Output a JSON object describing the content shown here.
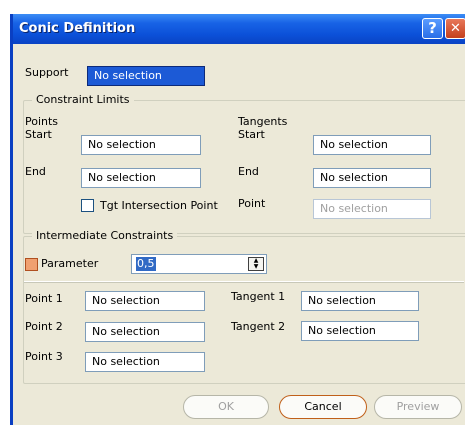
{
  "window": {
    "title": "Conic Definition",
    "help_glyph": "?",
    "close_glyph": "✕"
  },
  "support": {
    "label": "Support",
    "value": "No selection"
  },
  "constraint_limits": {
    "legend": "Constraint Limits",
    "points": {
      "heading": "Points",
      "start_label": "Start",
      "start_value": "No selection",
      "end_label": "End",
      "end_value": "No selection"
    },
    "tangents": {
      "heading": "Tangents",
      "start_label": "Start",
      "start_value": "No selection",
      "end_label": "End",
      "end_value": "No selection",
      "point_label": "Point",
      "point_value": "No selection"
    },
    "tgt_intersection_label": "Tgt Intersection Point"
  },
  "intermediate": {
    "legend": "Intermediate Constraints",
    "parameter_label": "Parameter",
    "parameter_value": "0,5",
    "point1_label": "Point 1",
    "point1_value": "No selection",
    "point2_label": "Point 2",
    "point2_value": "No selection",
    "point3_label": "Point 3",
    "point3_value": "No selection",
    "tangent1_label": "Tangent 1",
    "tangent1_value": "No selection",
    "tangent2_label": "Tangent 2",
    "tangent2_value": "No selection"
  },
  "buttons": {
    "ok": "OK",
    "cancel": "Cancel",
    "preview": "Preview"
  },
  "colors": {
    "titlebar": "#0b50d8",
    "selection": "#1c5ad6",
    "dialog_bg": "#ece9d8",
    "accent_orange": "#f0a070"
  },
  "icons": {
    "help": "help-icon",
    "close": "close-icon",
    "spinner": "spinner-icon",
    "checkbox": "checkbox-icon"
  }
}
